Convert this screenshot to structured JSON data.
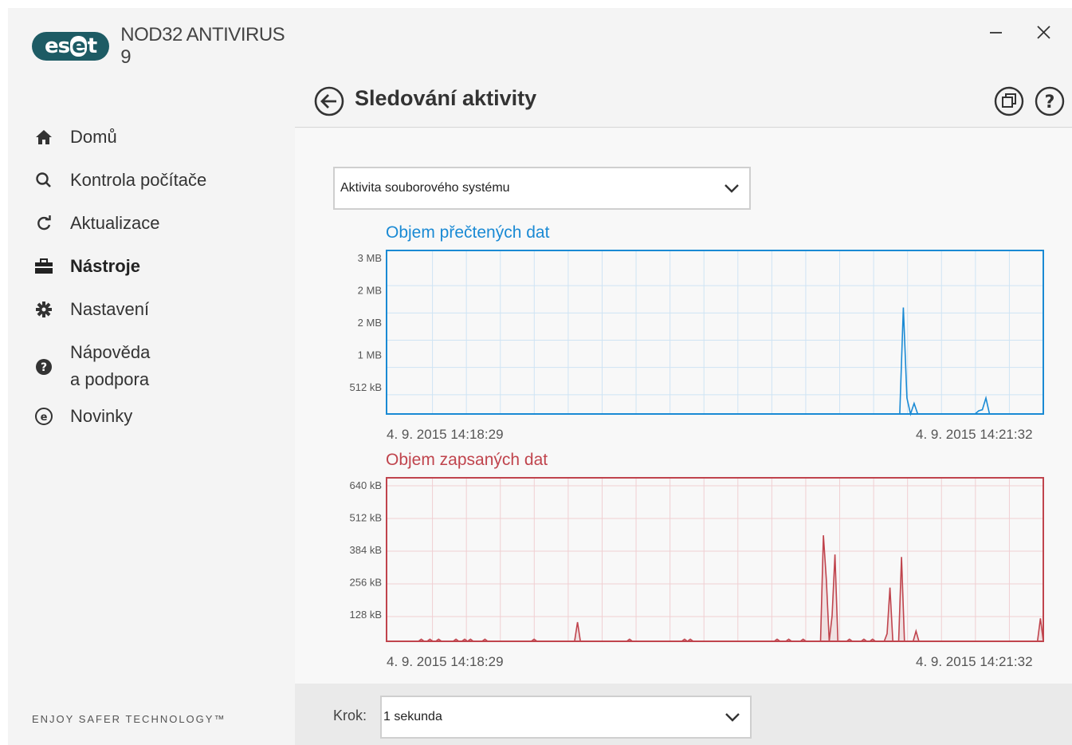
{
  "app": {
    "logo_text": "eset",
    "title": "NOD32 ANTIVIRUS 9",
    "tagline": "ENJOY SAFER TECHNOLOGY™"
  },
  "window_controls": {
    "minimize_icon": "minimize-icon",
    "close_icon": "close-icon"
  },
  "sidebar": {
    "items": [
      {
        "label": "Domů",
        "icon": "home-icon",
        "active": false
      },
      {
        "label": "Kontrola počítače",
        "icon": "search-icon",
        "active": false
      },
      {
        "label": "Aktualizace",
        "icon": "refresh-icon",
        "active": false
      },
      {
        "label": "Nástroje",
        "icon": "toolbox-icon",
        "active": true
      },
      {
        "label": "Nastavení",
        "icon": "gear-icon",
        "active": false
      },
      {
        "label": "Nápověda\na podpora",
        "label_line1": "Nápověda",
        "label_line2": "a podpora",
        "icon": "help-icon",
        "active": false
      },
      {
        "label": "Novinky",
        "icon": "news-icon",
        "active": false
      }
    ]
  },
  "header": {
    "title": "Sledování aktivity",
    "back_icon": "back-arrow-icon",
    "window_icon": "open-window-icon",
    "help_icon": "help-circle-icon"
  },
  "activity_select": {
    "value": "Aktivita souborového systému"
  },
  "step": {
    "label": "Krok:",
    "value": "1 sekunda"
  },
  "colors": {
    "read": "#1a8ad4",
    "write": "#c0444d",
    "brand": "#1d5b64"
  },
  "chart_data": [
    {
      "type": "line",
      "title": "Objem přečtených dat",
      "y_ticks": [
        "3 MB",
        "2 MB",
        "2 MB",
        "1 MB",
        "512 kB"
      ],
      "y_tick_values_kb": [
        2560,
        2048,
        1536,
        1024,
        512
      ],
      "ylim_kb": [
        0,
        3072
      ],
      "x_start": "4. 9. 2015 14:18:29",
      "x_end": "4. 9. 2015 14:21:32",
      "grid": true,
      "series": [
        {
          "values": [
            0,
            0,
            0,
            0,
            0,
            0,
            0,
            0,
            0,
            0,
            0,
            0,
            0,
            0,
            0,
            0,
            0,
            0,
            0,
            0,
            0,
            0,
            0,
            0,
            0,
            0,
            0,
            0,
            0,
            0,
            0,
            0,
            0,
            0,
            0,
            0,
            0,
            0,
            0,
            0,
            0,
            0,
            0,
            0,
            0,
            0,
            0,
            0,
            0,
            0,
            0,
            0,
            0,
            0,
            0,
            0,
            0,
            0,
            0,
            0,
            0,
            0,
            0,
            0,
            0,
            0,
            0,
            0,
            0,
            0,
            0,
            0,
            0,
            0,
            0,
            0,
            0,
            0,
            0,
            0,
            0,
            0,
            0,
            0,
            0,
            0,
            0,
            0,
            0,
            0,
            0,
            0,
            0,
            0,
            0,
            0,
            0,
            0,
            0,
            0,
            0,
            0,
            0,
            0,
            0,
            0,
            0,
            0,
            0,
            0,
            0,
            0,
            0,
            0,
            0,
            0,
            0,
            0,
            0,
            0,
            0,
            0,
            0,
            0,
            0,
            0,
            0,
            0,
            0,
            0,
            0,
            0,
            0,
            0,
            0,
            0,
            0,
            0,
            0,
            0,
            0,
            0,
            0,
            0,
            2000,
            300,
            0,
            200,
            0,
            0,
            0,
            0,
            0,
            0,
            0,
            0,
            0,
            0,
            0,
            0,
            0,
            0,
            0,
            0,
            0,
            60,
            80,
            300,
            0,
            0,
            0,
            0,
            0,
            0,
            0,
            0,
            0,
            0,
            0,
            0,
            0,
            0,
            0,
            0
          ]
        }
      ]
    },
    {
      "type": "area",
      "title": "Objem zapsaných dat",
      "y_ticks": [
        "640 kB",
        "512 kB",
        "384 kB",
        "256 kB",
        "128 kB"
      ],
      "y_tick_values_kb": [
        640,
        512,
        384,
        256,
        128
      ],
      "ylim_kb": [
        0,
        640
      ],
      "x_start": "4. 9. 2015 14:18:29",
      "x_end": "4. 9. 2015 14:21:32",
      "grid": true,
      "series": [
        {
          "values": [
            0,
            0,
            0,
            0,
            0,
            0,
            0,
            0,
            0,
            0,
            0,
            0,
            8,
            0,
            0,
            8,
            0,
            0,
            8,
            0,
            0,
            0,
            0,
            0,
            8,
            0,
            0,
            8,
            0,
            8,
            0,
            0,
            0,
            0,
            8,
            0,
            0,
            0,
            0,
            0,
            0,
            0,
            0,
            0,
            0,
            0,
            0,
            0,
            0,
            0,
            0,
            8,
            0,
            0,
            0,
            0,
            0,
            0,
            0,
            0,
            0,
            0,
            0,
            0,
            0,
            0,
            75,
            0,
            0,
            0,
            0,
            0,
            0,
            0,
            0,
            0,
            0,
            0,
            0,
            0,
            0,
            0,
            0,
            0,
            8,
            0,
            0,
            0,
            0,
            0,
            0,
            0,
            0,
            0,
            0,
            0,
            0,
            0,
            0,
            0,
            0,
            0,
            0,
            8,
            0,
            8,
            0,
            0,
            0,
            0,
            0,
            0,
            0,
            0,
            0,
            0,
            0,
            0,
            0,
            0,
            0,
            0,
            0,
            0,
            0,
            0,
            0,
            0,
            0,
            0,
            0,
            0,
            0,
            0,
            0,
            8,
            0,
            0,
            0,
            8,
            0,
            0,
            0,
            0,
            8,
            0,
            0,
            0,
            0,
            0,
            0,
            415,
            240,
            0,
            100,
            340,
            0,
            0,
            0,
            0,
            8,
            0,
            0,
            0,
            0,
            8,
            0,
            0,
            8,
            0,
            0,
            0,
            0,
            30,
            210,
            0,
            0,
            0,
            330,
            0,
            0,
            0,
            0,
            40,
            0,
            0,
            0,
            0,
            0,
            0,
            0,
            0,
            0,
            0,
            0,
            0,
            0,
            0,
            0,
            0,
            0,
            0,
            0,
            0,
            0,
            0,
            0,
            0,
            0,
            0,
            0,
            0,
            0,
            0,
            0,
            0,
            0,
            0,
            0,
            0,
            0,
            0,
            0,
            0,
            0,
            0,
            90,
            0
          ]
        }
      ]
    }
  ]
}
